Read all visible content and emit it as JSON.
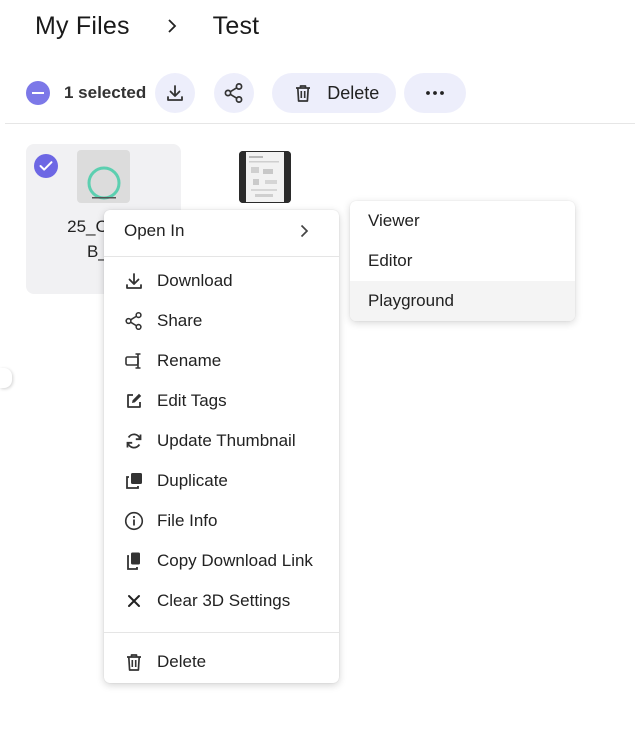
{
  "breadcrumb": {
    "root": "My Files",
    "current": "Test"
  },
  "toolbar": {
    "selected_label": "1 selected",
    "delete_label": "Delete",
    "accent_color": "#7c78e8",
    "button_bg": "#edeefb"
  },
  "files": [
    {
      "name_line1": "25_CO01",
      "name_line2": "B_R",
      "selected": true
    },
    {
      "name_line1": "",
      "name_line2": "",
      "selected": false
    }
  ],
  "context_menu": {
    "open_in": "Open In",
    "items": [
      {
        "label": "Download",
        "icon": "download-icon"
      },
      {
        "label": "Share",
        "icon": "share-icon"
      },
      {
        "label": "Rename",
        "icon": "rename-icon"
      },
      {
        "label": "Edit Tags",
        "icon": "edit-icon"
      },
      {
        "label": "Update Thumbnail",
        "icon": "refresh-icon"
      },
      {
        "label": "Duplicate",
        "icon": "duplicate-icon"
      },
      {
        "label": "File Info",
        "icon": "info-icon"
      },
      {
        "label": "Copy Download Link",
        "icon": "copy-icon"
      },
      {
        "label": "Clear 3D Settings",
        "icon": "close-icon"
      }
    ],
    "delete": "Delete"
  },
  "submenu": {
    "items": [
      "Viewer",
      "Editor",
      "Playground"
    ],
    "hovered": "Playground"
  }
}
